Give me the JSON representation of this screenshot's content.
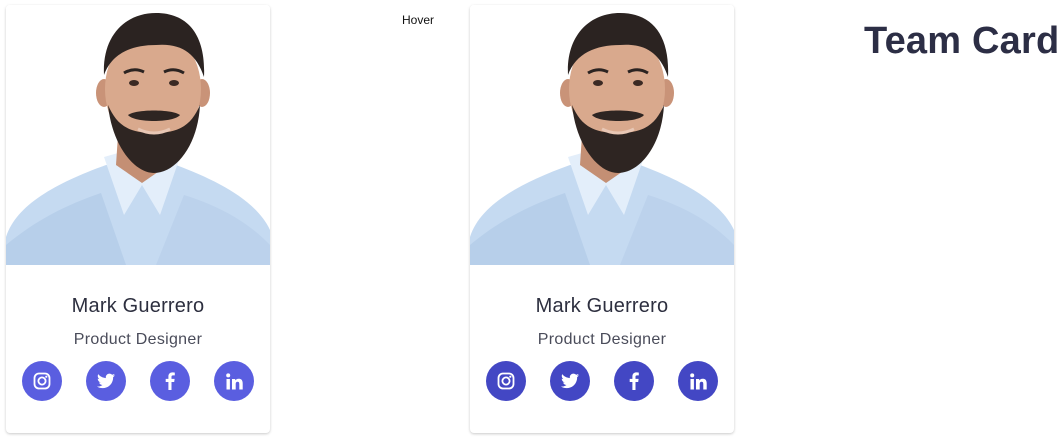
{
  "page": {
    "title": "Team Card",
    "hover_label": "Hover"
  },
  "cards": [
    {
      "state": "default",
      "name": "Mark Guerrero",
      "role": "Product Designer",
      "social_color": "#5a5ee0",
      "socials": [
        {
          "icon": "instagram-icon"
        },
        {
          "icon": "twitter-icon"
        },
        {
          "icon": "facebook-icon"
        },
        {
          "icon": "linkedin-icon"
        }
      ]
    },
    {
      "state": "hover",
      "name": "Mark Guerrero",
      "role": "Product Designer",
      "social_color": "#4347c4",
      "socials": [
        {
          "icon": "instagram-icon"
        },
        {
          "icon": "twitter-icon"
        },
        {
          "icon": "facebook-icon"
        },
        {
          "icon": "linkedin-icon"
        }
      ]
    }
  ],
  "colors": {
    "title": "#2c2e45",
    "shirt": "#c8dcf2",
    "hair": "#2a2220",
    "skin": "#d7a68a"
  }
}
